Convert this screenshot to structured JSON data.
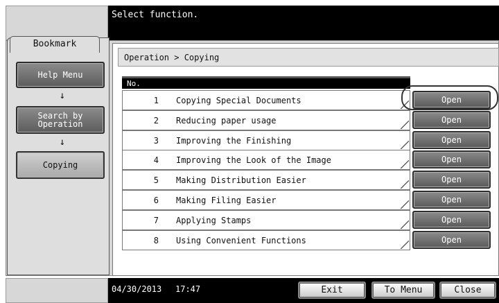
{
  "header": {
    "title": "Select function."
  },
  "sidebar": {
    "tab_label": "Bookmark",
    "items": [
      {
        "label": "Help Menu"
      },
      {
        "label": "Search by\nOperation"
      },
      {
        "label": "Copying"
      }
    ],
    "arrow_icon": "↓"
  },
  "breadcrumb": "Operation > Copying",
  "table": {
    "header_label": "No.",
    "rows": [
      {
        "num": "1",
        "title": "Copying Special Documents"
      },
      {
        "num": "2",
        "title": "Reducing paper usage"
      },
      {
        "num": "3",
        "title": "Improving the Finishing"
      },
      {
        "num": "4",
        "title": "Improving the Look of the Image"
      },
      {
        "num": "5",
        "title": "Making Distribution Easier"
      },
      {
        "num": "6",
        "title": "Making Filing Easier"
      },
      {
        "num": "7",
        "title": "Applying Stamps"
      },
      {
        "num": "8",
        "title": "Using Convenient Functions"
      }
    ],
    "open_label": "Open"
  },
  "footer": {
    "date": "04/30/2013",
    "time": "17:47",
    "exit_label": "Exit",
    "to_menu_label": "To Menu",
    "close_label": "Close"
  }
}
